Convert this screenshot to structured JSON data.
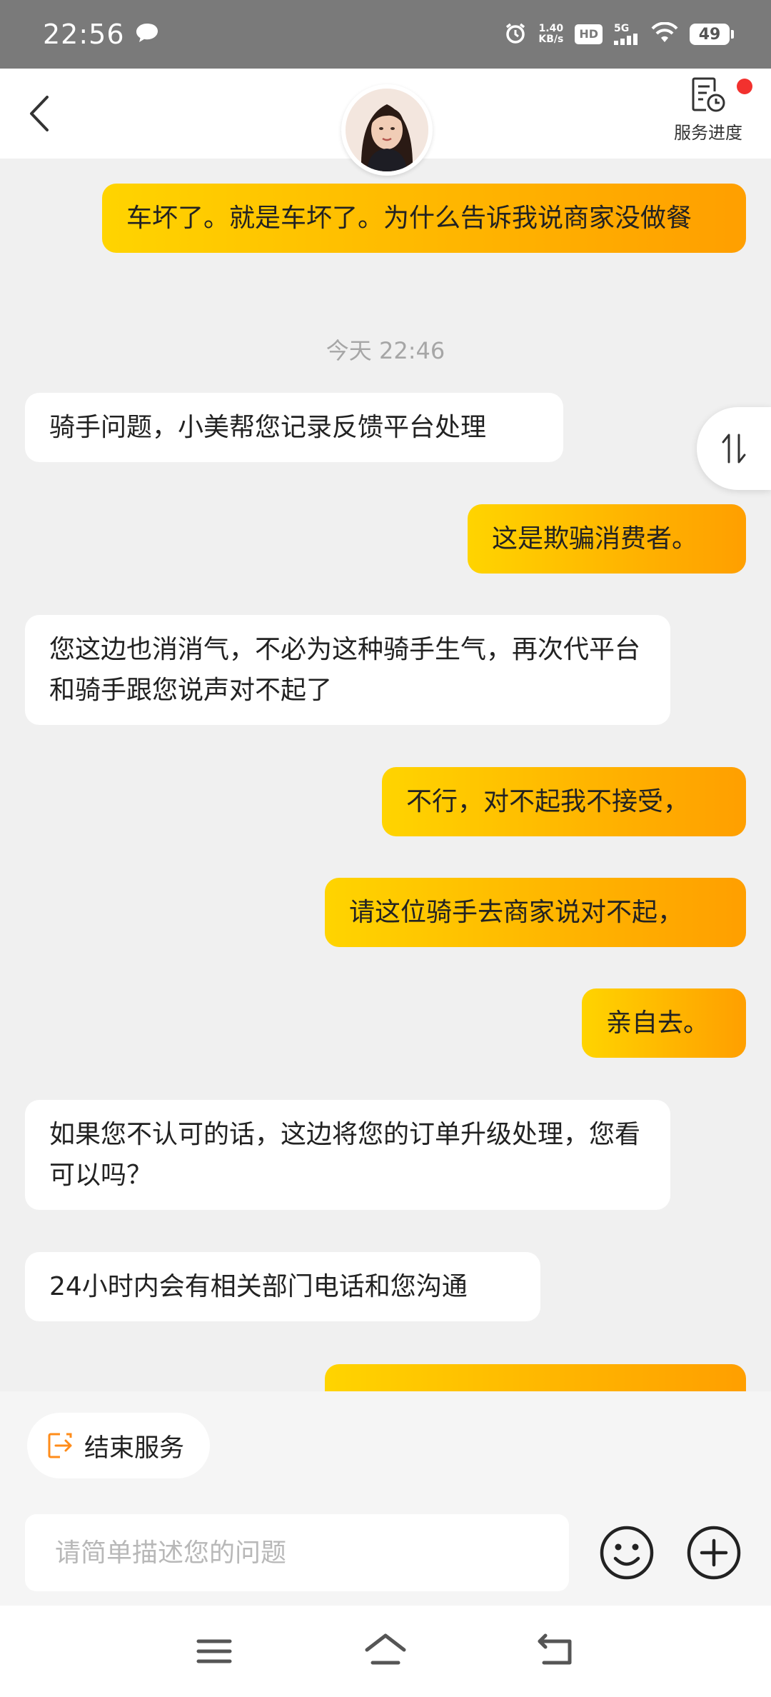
{
  "status_bar": {
    "time": "22:56",
    "net_speed_value": "1.40",
    "net_speed_unit": "KB/s",
    "hd": "HD",
    "network": "5G",
    "battery": "49"
  },
  "header": {
    "progress_label": "服务进度"
  },
  "chat": {
    "messages": [
      {
        "from": "user",
        "text": "车坏了。就是车坏了。为什么告诉我说商家没做餐"
      },
      {
        "timestamp": "今天 22:46"
      },
      {
        "from": "agent",
        "text": "骑手问题，小美帮您记录反馈平台处理"
      },
      {
        "from": "user",
        "text": "这是欺骗消费者。"
      },
      {
        "from": "agent",
        "text": "您这边也消消气，不必为这种骑手生气，再次代平台和骑手跟您说声对不起了"
      },
      {
        "from": "user",
        "text": "不行，对不起我不接受，"
      },
      {
        "from": "user",
        "text": "请这位骑手去商家说对不起，"
      },
      {
        "from": "user",
        "text": "亲自去。"
      },
      {
        "from": "agent",
        "text": "如果您不认可的话，这边将您的订单升级处理，您看可以吗？"
      },
      {
        "from": "agent",
        "text": "24小时内会有相关部门电话和您沟通"
      }
    ]
  },
  "actions": {
    "end_service": "结束服务"
  },
  "input": {
    "placeholder": "请简单描述您的问题"
  },
  "colors": {
    "user_bubble_start": "#ffd400",
    "user_bubble_end": "#ff9f00",
    "accent_orange": "#ff8c1a",
    "notification_dot": "#f2312e"
  },
  "icons": [
    "back-arrow-icon",
    "service-progress-icon",
    "sort-swap-icon",
    "exit-icon",
    "emoji-icon",
    "plus-icon",
    "menu-icon",
    "home-icon",
    "back-icon"
  ]
}
